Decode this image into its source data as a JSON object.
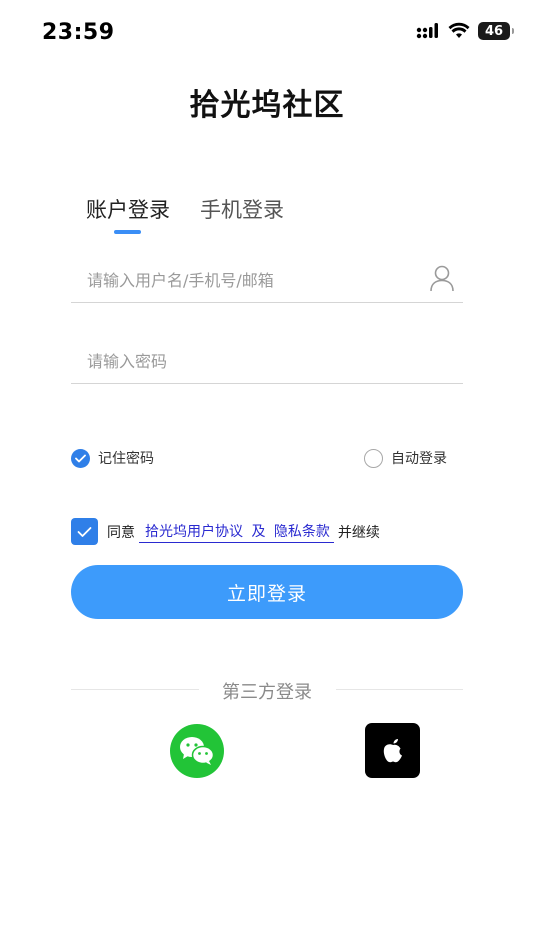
{
  "status_bar": {
    "time": "23:59",
    "battery": "46"
  },
  "header": {
    "title": "拾光坞社区"
  },
  "tabs": [
    {
      "label": "账户登录",
      "active": true
    },
    {
      "label": "手机登录",
      "active": false
    }
  ],
  "form": {
    "username_placeholder": "请输入用户名/手机号/邮箱",
    "password_placeholder": "请输入密码",
    "remember_label": "记住密码",
    "remember_checked": true,
    "autologin_label": "自动登录",
    "autologin_checked": false
  },
  "agreement": {
    "checked": true,
    "prefix": "同意",
    "user_agreement": "拾光坞用户协议",
    "and": "及",
    "privacy": "隐私条款",
    "suffix": "并继续"
  },
  "login_button": "立即登录",
  "third_party": {
    "label": "第三方登录",
    "options": [
      "wechat-icon",
      "apple-icon"
    ]
  },
  "colors": {
    "accent": "#3d9bfb",
    "check": "#2f7fe8",
    "link": "#2a2ad0",
    "wechat": "#22c437"
  }
}
